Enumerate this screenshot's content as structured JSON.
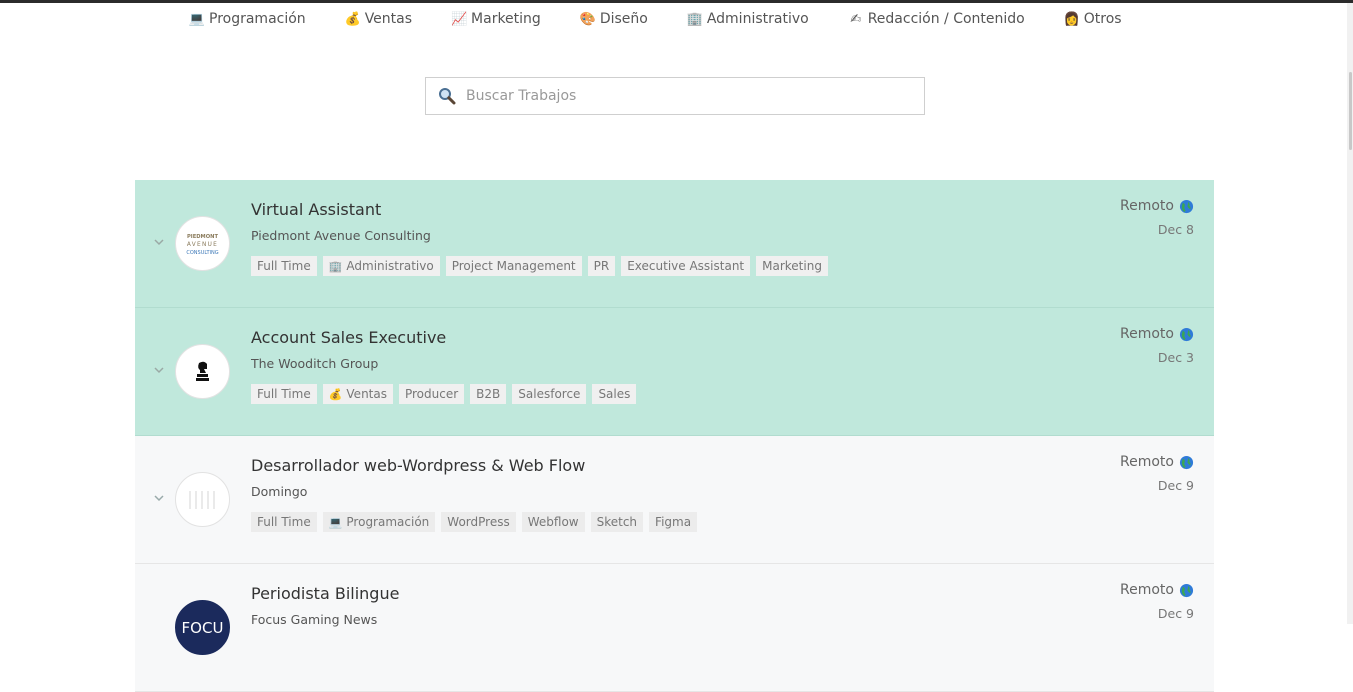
{
  "categories": [
    {
      "label": "Programación",
      "emoji": "💻"
    },
    {
      "label": "Ventas",
      "emoji": "💰"
    },
    {
      "label": "Marketing",
      "emoji": "📈"
    },
    {
      "label": "Diseño",
      "emoji": "🎨"
    },
    {
      "label": "Administrativo",
      "emoji": "🏢"
    },
    {
      "label": "Redacción / Contenido",
      "emoji": "✍"
    },
    {
      "label": "Otros",
      "emoji": "👩"
    }
  ],
  "search": {
    "placeholder": "Buscar Trabajos",
    "value": ""
  },
  "jobs": [
    {
      "title": "Virtual Assistant",
      "company": "Piedmont Avenue Consulting",
      "logo_text": [
        "PIEDMONT",
        "AVENUE",
        "CONSULTING"
      ],
      "remote_label": "Remoto",
      "date": "Dec 8",
      "featured": true,
      "tags": [
        {
          "label": "Full Time",
          "emoji": ""
        },
        {
          "label": "Administrativo",
          "emoji": "🏢"
        },
        {
          "label": "Project Management",
          "emoji": ""
        },
        {
          "label": "PR",
          "emoji": ""
        },
        {
          "label": "Executive Assistant",
          "emoji": ""
        },
        {
          "label": "Marketing",
          "emoji": ""
        }
      ]
    },
    {
      "title": "Account Sales Executive",
      "company": "The Wooditch Group",
      "logo_text": [],
      "remote_label": "Remoto",
      "date": "Dec 3",
      "featured": true,
      "tags": [
        {
          "label": "Full Time",
          "emoji": ""
        },
        {
          "label": "Ventas",
          "emoji": "💰"
        },
        {
          "label": "Producer",
          "emoji": ""
        },
        {
          "label": "B2B",
          "emoji": ""
        },
        {
          "label": "Salesforce",
          "emoji": ""
        },
        {
          "label": "Sales",
          "emoji": ""
        }
      ]
    },
    {
      "title": "Desarrollador web-Wordpress & Web Flow",
      "company": "Domingo",
      "logo_text": [],
      "remote_label": "Remoto",
      "date": "Dec 9",
      "featured": false,
      "tags": [
        {
          "label": "Full Time",
          "emoji": ""
        },
        {
          "label": "Programación",
          "emoji": "💻"
        },
        {
          "label": "WordPress",
          "emoji": ""
        },
        {
          "label": "Webflow",
          "emoji": ""
        },
        {
          "label": "Sketch",
          "emoji": ""
        },
        {
          "label": "Figma",
          "emoji": ""
        }
      ]
    },
    {
      "title": "Periodista Bilingue",
      "company": "Focus Gaming News",
      "logo_text": [
        "FOCU"
      ],
      "remote_label": "Remoto",
      "date": "Dec 9",
      "featured": false,
      "tags": []
    }
  ],
  "colors": {
    "featured_bg": "#c0e8dc",
    "normal_bg": "#f7f8f9",
    "accent_dark": "#1b2a5c"
  }
}
